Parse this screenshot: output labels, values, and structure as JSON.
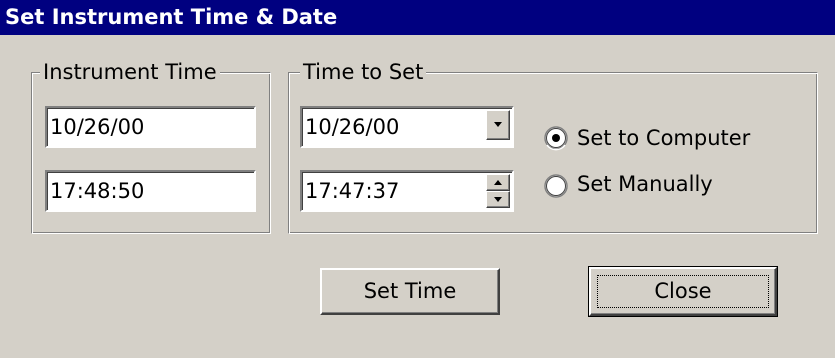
{
  "window": {
    "title": "Set Instrument Time & Date"
  },
  "instrument_time": {
    "group_label": "Instrument Time",
    "date_value": "10/26/00",
    "time_value": "17:48:50"
  },
  "time_to_set": {
    "group_label": "Time to Set",
    "date_value": "10/26/00",
    "time_value": "17:47:37",
    "options": [
      "Set to Computer",
      "Set Manually"
    ],
    "selected_option": "Set to Computer"
  },
  "buttons": {
    "set_time": "Set Time",
    "close": "Close"
  },
  "colors": {
    "titlebar": "#000080",
    "face": "#d4d0c8"
  }
}
